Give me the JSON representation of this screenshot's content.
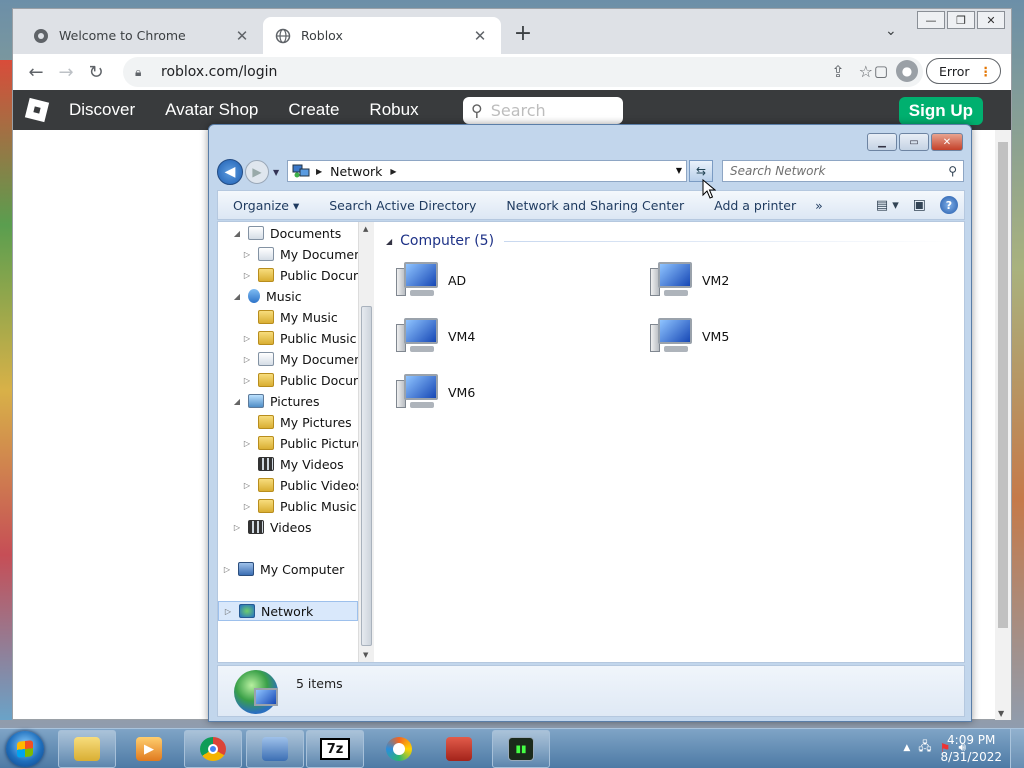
{
  "chrome": {
    "tabs": [
      {
        "title": "Welcome to Chrome",
        "active": false
      },
      {
        "title": "Roblox",
        "active": true
      }
    ],
    "url": "roblox.com/login",
    "profile_error": "Error"
  },
  "roblox": {
    "nav": [
      "Discover",
      "Avatar Shop",
      "Create",
      "Robux"
    ],
    "search_placeholder": "Search",
    "signup": "Sign Up"
  },
  "explorer": {
    "address": "Network",
    "search_placeholder": "Search Network",
    "commands": [
      "Organize",
      "Search Active Directory",
      "Network and Sharing Center",
      "Add a printer"
    ],
    "more_glyph": "»",
    "tree": [
      {
        "label": "Documents",
        "indent": 1,
        "expanded": true,
        "icon": "lib"
      },
      {
        "label": "My Documents",
        "indent": 2,
        "icon": "lib"
      },
      {
        "label": "Public Documents",
        "indent": 2,
        "icon": "folder"
      },
      {
        "label": "Music",
        "indent": 1,
        "expanded": true,
        "icon": "music"
      },
      {
        "label": "My Music",
        "indent": 2,
        "icon": "folder",
        "no_toggle": true
      },
      {
        "label": "Public Music",
        "indent": 2,
        "icon": "folder"
      },
      {
        "label": "My Documents",
        "indent": 2,
        "icon": "lib"
      },
      {
        "label": "Public Documents",
        "indent": 2,
        "icon": "folder"
      },
      {
        "label": "Pictures",
        "indent": 1,
        "expanded": true,
        "icon": "pic"
      },
      {
        "label": "My Pictures",
        "indent": 2,
        "icon": "folder",
        "no_toggle": true
      },
      {
        "label": "Public Pictures",
        "indent": 2,
        "icon": "folder"
      },
      {
        "label": "My Videos",
        "indent": 2,
        "icon": "vid",
        "no_toggle": true
      },
      {
        "label": "Public Videos",
        "indent": 2,
        "icon": "folder"
      },
      {
        "label": "Public Music",
        "indent": 2,
        "icon": "folder"
      },
      {
        "label": "Videos",
        "indent": 1,
        "icon": "vid"
      },
      {
        "label": "My Computer",
        "indent": 0,
        "icon": "pc",
        "gap": true
      },
      {
        "label": "Network",
        "indent": 0,
        "icon": "net",
        "gap": true,
        "selected": true
      }
    ],
    "group_header": "Computer (5)",
    "computers": [
      "AD",
      "VM2",
      "VM4",
      "VM5",
      "VM6"
    ],
    "details": "5 items"
  },
  "taskbar": {
    "time": "4:09 PM",
    "date": "8/31/2022",
    "apps": [
      "explorer",
      "media-player",
      "chrome",
      "network-center",
      "7zip",
      "opera",
      "presentation",
      "terminal"
    ]
  }
}
